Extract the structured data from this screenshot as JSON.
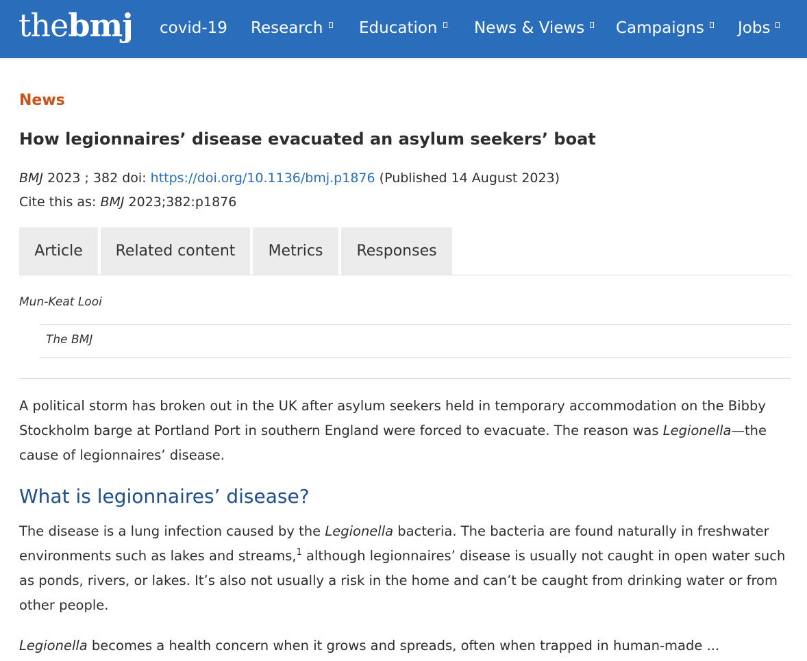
{
  "header": {
    "logo_thin": "the",
    "logo_bold": "bmj",
    "nav": [
      {
        "label": "covid-19",
        "has_menu": false
      },
      {
        "label": "Research",
        "has_menu": true
      },
      {
        "label": "Education",
        "has_menu": true
      },
      {
        "label": "News & Views",
        "has_menu": true
      },
      {
        "label": "Campaigns",
        "has_menu": true
      },
      {
        "label": "Jobs",
        "has_menu": true
      }
    ]
  },
  "article": {
    "section": "News",
    "title": "How legionnaires’ disease evacuated an asylum seekers’ boat",
    "journal": "BMJ",
    "year_vol": "2023 ; 382",
    "doi_label": "doi:",
    "doi_link": "https://doi.org/10.1136/bmj.p1876",
    "published": "(Published 14 August 2023)",
    "cite_label": "Cite this as:",
    "cite_journal": "BMJ",
    "cite_ref": "2023;382:p1876"
  },
  "tabs": [
    "Article",
    "Related content",
    "Metrics",
    "Responses"
  ],
  "author": "Mun-Keat Looi",
  "affiliation": "The BMJ",
  "body": {
    "p1_a": "A political storm has broken out in the UK after asylum seekers held in temporary accommodation on the Bibby Stockholm barge at Portland Port in southern England were forced to evacuate. The reason was ",
    "p1_italic": "Legionella",
    "p1_b": "—the cause of legionnaires’ disease.",
    "h2": "What is legionnaires’ disease?",
    "p2_a": "The disease is a lung infection caused by the ",
    "p2_italic": "Legionella",
    "p2_b": " bacteria. The bacteria are found naturally in freshwater environments such as lakes and streams,",
    "p2_ref": "1",
    "p2_c": "  although legionnaires’ disease is usually not caught in open water such as ponds, rivers, or lakes. It’s also not usually a risk in the home and can’t be caught from drinking water or from other people.",
    "p3_italic": "Legionella",
    "p3_b": " becomes a health concern when it grows and spreads, often when trapped in human-made ..."
  },
  "colors": {
    "brand": "#2a6ebb",
    "section": "#c8531a",
    "heading": "#1f4e8c"
  }
}
